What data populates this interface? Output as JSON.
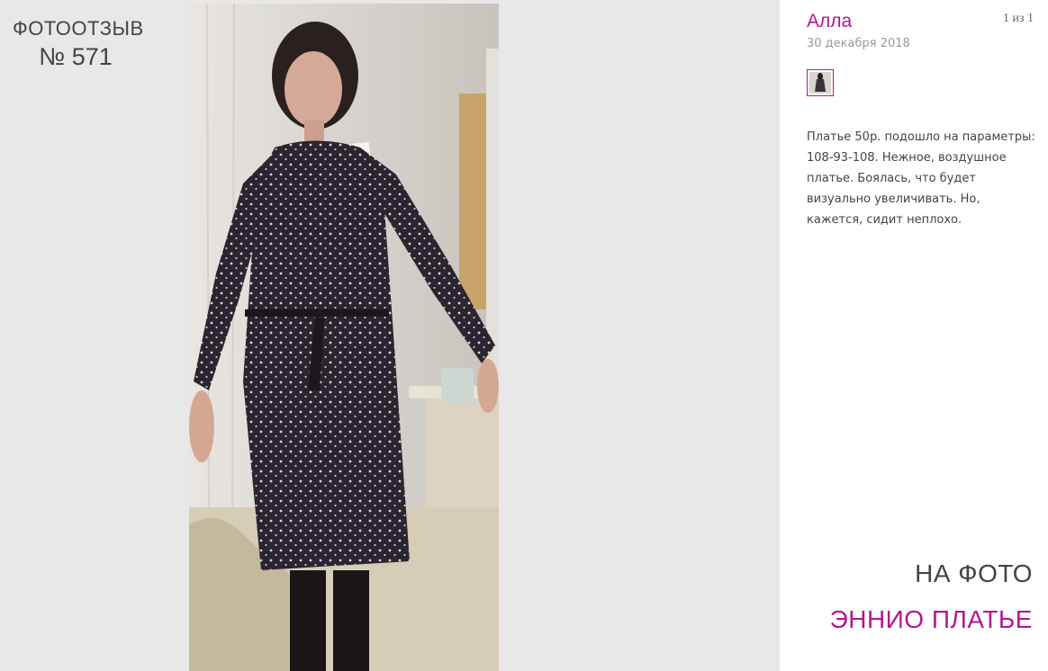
{
  "heading": {
    "line1": "ФОТООТЗЫВ",
    "line2": "№ 571"
  },
  "photo": {
    "subject": "woman in polka-dot dress"
  },
  "review": {
    "author": "Алла",
    "date": "30 декабря 2018",
    "counter": "1 из 1",
    "text": "Платье 50р. подошло на параметры: 108-93-108. Нежное, воздушное платье. Боялась, что будет визуально увеличивать. Но, кажется, сидит неплохо."
  },
  "on_photo": {
    "label": "НА ФОТО",
    "product": "ЭННИО ПЛАТЬЕ"
  },
  "colors": {
    "accent": "#b5178f",
    "panel_bg": "#e8e8e8",
    "text": "#444444"
  }
}
